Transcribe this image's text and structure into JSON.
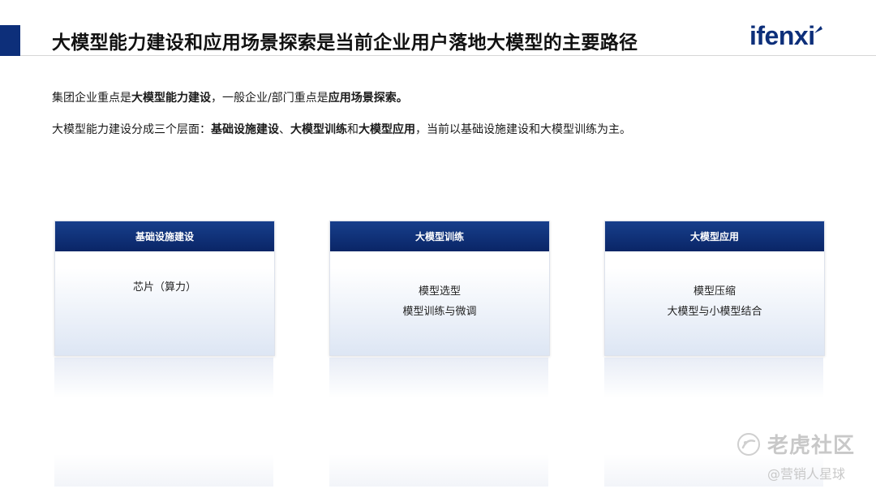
{
  "slide": {
    "title": "大模型能力建设和应用场景探索是当前企业用户落地大模型的主要路径",
    "logo": "ifenxi"
  },
  "body": {
    "line1": {
      "p1": "集团企业重点是",
      "b1": "大模型能力建设",
      "p2": "，一般企业/部门重点是",
      "b2": "应用场景探索。"
    },
    "line2": {
      "p1": "大模型能力建设分成三个层面：",
      "b1": "基础设施建设",
      "p2": "、",
      "b2": "大模型训练",
      "p3": "和",
      "b3": "大模型应用",
      "p4": "，当前以基础设施建设和大模型训练为主。"
    }
  },
  "cards": [
    {
      "title": "基础设施建设",
      "items": [
        "芯片（算力）"
      ]
    },
    {
      "title": "大模型训练",
      "items": [
        "模型选型",
        "模型训练与微调"
      ]
    },
    {
      "title": "大模型应用",
      "items": [
        "模型压缩",
        "大模型与小模型结合"
      ]
    }
  ],
  "watermark": {
    "main": "老虎社区",
    "sub": "@营销人星球"
  },
  "colors": {
    "accent": "#0d2f7a",
    "card_header": "#0a2566",
    "logo": "#0d2f7a"
  }
}
